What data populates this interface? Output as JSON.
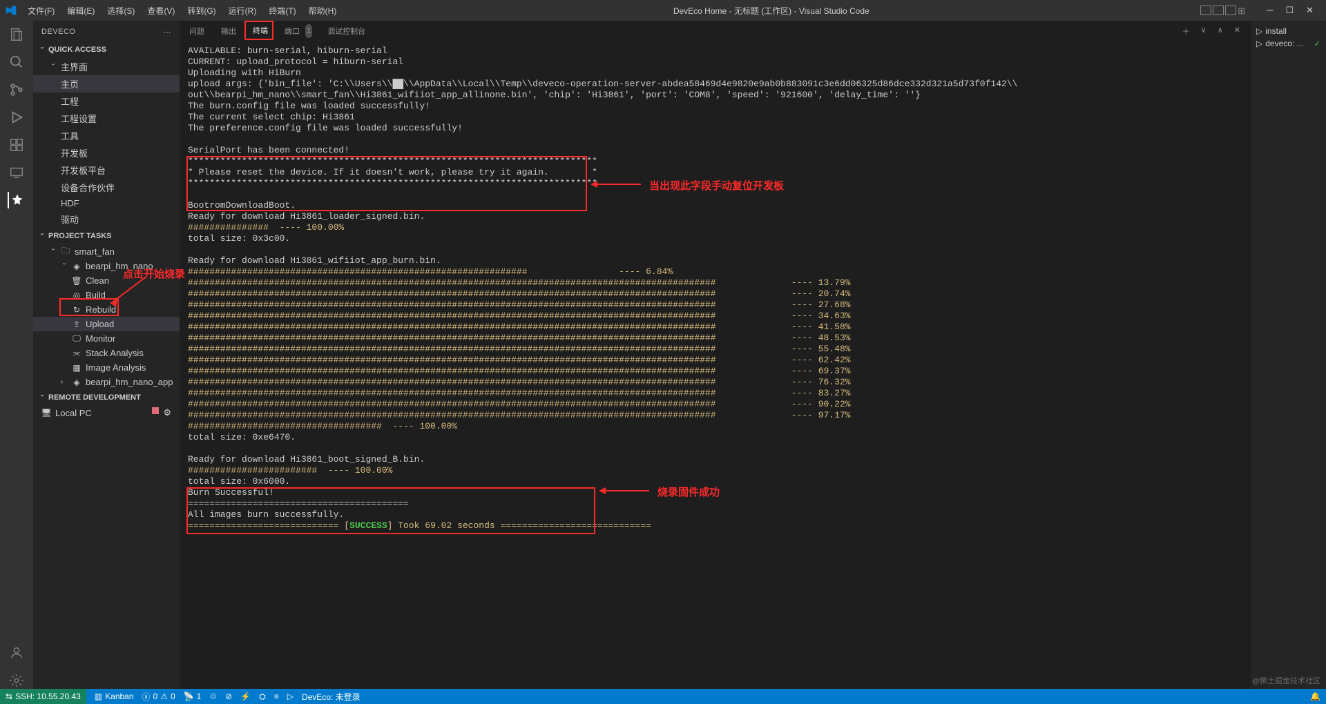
{
  "titlebar": {
    "menus": [
      "文件(F)",
      "编辑(E)",
      "选择(S)",
      "查看(V)",
      "转到(G)",
      "运行(R)",
      "终端(T)",
      "帮助(H)"
    ],
    "title": "DevEco Home - 无标题 (工作区) - Visual Studio Code"
  },
  "sidebar": {
    "title": "DEVECO",
    "sections": {
      "quick_access": {
        "label": "QUICK ACCESS",
        "items": [
          {
            "label": "主界面",
            "children": [
              "主页",
              "工程",
              "工程设置",
              "工具",
              "开发板",
              "开发板平台",
              "设备合作伙伴",
              "HDF",
              "驱动"
            ]
          }
        ]
      },
      "project_tasks": {
        "label": "PROJECT TASKS",
        "root": "smart_fan",
        "board": "bearpi_hm_nano",
        "tasks": [
          "Clean",
          "Build",
          "Rebuild",
          "Upload",
          "Monitor",
          "Stack Analysis",
          "Image Analysis"
        ],
        "app": "bearpi_hm_nano_app"
      },
      "remote_dev": {
        "label": "REMOTE DEVELOPMENT",
        "item": "Local PC"
      }
    }
  },
  "panel": {
    "tabs": [
      "问题",
      "输出",
      "终端",
      "端口",
      "调试控制台"
    ],
    "active": "终端",
    "port_badge": "1"
  },
  "terminal_lines": [
    "AVAILABLE: burn-serial, hiburn-serial",
    "CURRENT: upload_protocol = hiburn-serial",
    "Uploading with HiBurn",
    "upload args: {'bin_file': 'C:\\\\Users\\\\██\\\\AppData\\\\Local\\\\Temp\\\\deveco-operation-server-abdea58469d4e9820e9ab0b883091c3e6dd06325d86dce332d321a5d73f0f142\\\\",
    "out\\\\bearpi_hm_nano\\\\smart_fan\\\\Hi3861_wifiiot_app_allinone.bin', 'chip': 'Hi3861', 'port': 'COM8', 'speed': '921600', 'delay_time': ''}",
    "The burn.config file was loaded successfully!",
    "The current select chip: Hi3861",
    "The preference.config file was loaded successfully!",
    "",
    "SerialPort has been connected!",
    "****************************************************************************",
    "* Please reset the device. If it doesn't work, please try it again.        *",
    "****************************************************************************",
    "",
    "BootromDownloadBoot.",
    "Ready for download Hi3861_loader_signed.bin.",
    "###############  ---- 100.00%",
    "total size: 0x3c00.",
    "",
    "Ready for download Hi3861_wifiiot_app_burn.bin.",
    "###############################################################                 ---- 6.84%",
    "##################################################################################################              ---- 13.79%",
    "##################################################################################################              ---- 20.74%",
    "##################################################################################################              ---- 27.68%",
    "##################################################################################################              ---- 34.63%",
    "##################################################################################################              ---- 41.58%",
    "##################################################################################################              ---- 48.53%",
    "##################################################################################################              ---- 55.48%",
    "##################################################################################################              ---- 62.42%",
    "##################################################################################################              ---- 69.37%",
    "##################################################################################################              ---- 76.32%",
    "##################################################################################################              ---- 83.27%",
    "##################################################################################################              ---- 90.22%",
    "##################################################################################################              ---- 97.17%",
    "####################################  ---- 100.00%",
    "total size: 0xe6470.",
    "",
    "Ready for download Hi3861_boot_signed_B.bin.",
    "########################  ---- 100.00%",
    "total size: 0x6000.",
    "Burn Successful!",
    "=========================================",
    "All images burn successfully."
  ],
  "success_line": {
    "prefix": "============================ [",
    "success": "SUCCESS",
    "suffix": "] Took 69.02 seconds ============================"
  },
  "right_panel": {
    "items": [
      {
        "label": "install"
      },
      {
        "label": "deveco: ...",
        "status": "✓"
      }
    ]
  },
  "statusbar": {
    "remote": "SSH: 10.55.20.43",
    "kanban": "Kanban",
    "errors": "0",
    "warnings": "0",
    "ports": "1",
    "deveco": "DevEco: 未登录"
  },
  "annotations": {
    "upload_hint": "点击开始烧录",
    "reset_hint": "当出现此字段手动复位开发板",
    "success_hint": "烧录固件成功"
  },
  "watermark": "@稀土掘金技术社区"
}
